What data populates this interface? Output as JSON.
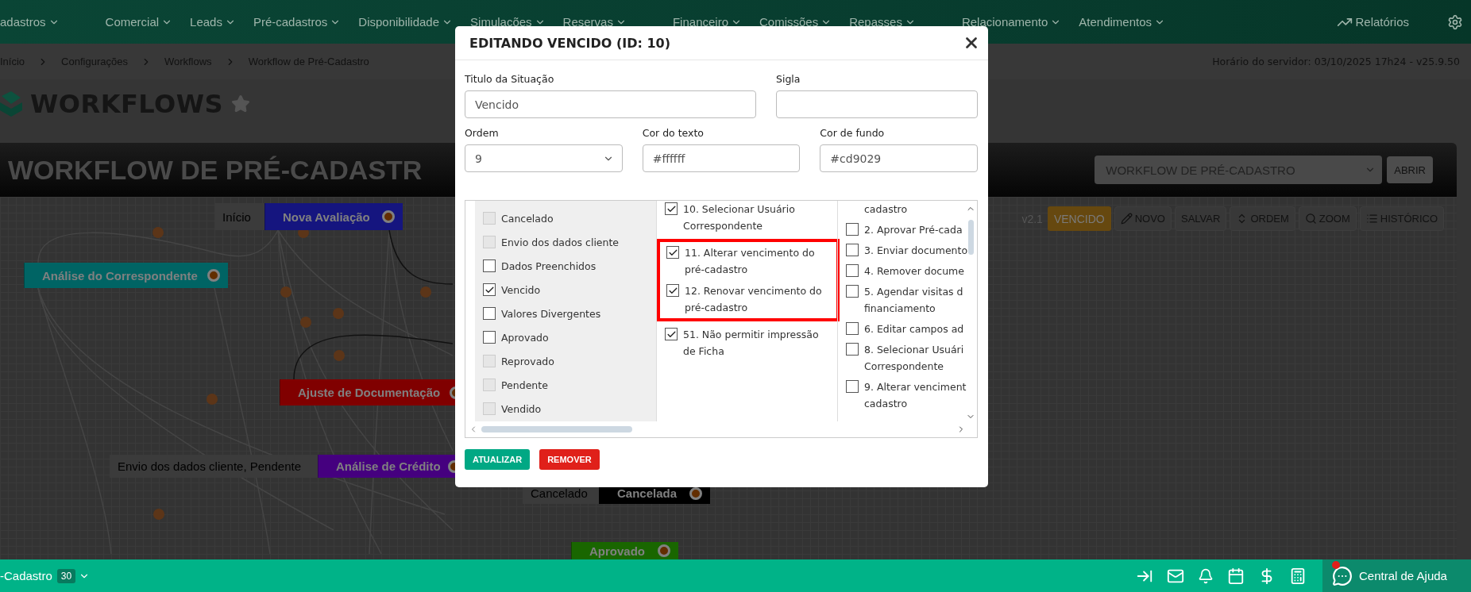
{
  "nav": {
    "items": [
      {
        "label": "adastros"
      },
      {
        "label": "Comercial"
      },
      {
        "label": "Leads"
      },
      {
        "label": "Pré-cadastros"
      },
      {
        "label": "Disponibilidade"
      },
      {
        "label": "Simulações"
      },
      {
        "label": "Reservas"
      },
      {
        "label": "Financeiro"
      },
      {
        "label": "Comissões"
      },
      {
        "label": "Repasses"
      },
      {
        "label": "Relacionamento"
      },
      {
        "label": "Atendimentos"
      }
    ],
    "reports": "Relatórios"
  },
  "breadcrumb": [
    "Início",
    "Configurações",
    "Workflows",
    "Workflow de Pré-Cadastro"
  ],
  "server_time": "Horário do servidor: 03/10/2025 17h24 - v25.9.50",
  "page_title": "WORKFLOWS",
  "banner": {
    "title": "WORKFLOW DE PRÉ-CADASTR",
    "select": "WORKFLOW DE PRÉ-CADASTRO",
    "button": "ABRIR"
  },
  "toolbar": {
    "version": "v2.1",
    "status": "VENCIDO",
    "buttons": [
      {
        "label": "NOVO",
        "kind": "pencil"
      },
      {
        "label": "SALVAR",
        "kind": "plain"
      },
      {
        "label": "ORDEM",
        "kind": "sort"
      },
      {
        "label": "ZOOM",
        "kind": "search"
      },
      {
        "label": "HISTÓRICO",
        "kind": "list"
      }
    ]
  },
  "canvas": {
    "nodes": [
      {
        "label": "Nova Avaliação",
        "tag": "Início",
        "color": "#15157f"
      },
      {
        "label": "Análise do Correspondente",
        "color": "#006464"
      },
      {
        "label": "Ajuste de Documentação",
        "color": "#800000"
      },
      {
        "label": "Análise de Crédito",
        "tag": "Envio dos dados cliente, Pendente",
        "color": "#45007f"
      },
      {
        "label": "Cancelada",
        "tag": "Cancelado",
        "color": "#000000"
      },
      {
        "label": "Aprovado",
        "color": "#196600"
      }
    ]
  },
  "modal": {
    "title": "EDITANDO VENCIDO (ID: 10)",
    "field_rows": [
      [
        {
          "label": "Titulo da Situação",
          "kind": "text",
          "value": "Vencido"
        },
        {
          "label": "Sigla",
          "kind": "text"
        }
      ],
      [
        {
          "label": "Ordem",
          "kind": "select",
          "value": "9"
        },
        {
          "label": "Cor do texto",
          "kind": "text",
          "value": "#ffffff"
        },
        {
          "label": "Cor de fundo",
          "kind": "text",
          "value": "#cd9029"
        }
      ]
    ],
    "situations": [
      {
        "label": "Cancelado",
        "checked": false,
        "disabled": true
      },
      {
        "label": "Envio dos dados cliente",
        "checked": false,
        "disabled": true
      },
      {
        "label": "Dados Preenchidos",
        "checked": false,
        "disabled": false
      },
      {
        "label": "Vencido",
        "checked": true,
        "disabled": false
      },
      {
        "label": "Valores Divergentes",
        "checked": false,
        "disabled": false
      },
      {
        "label": "Aprovado",
        "checked": false,
        "disabled": false
      },
      {
        "label": "Reprovado",
        "checked": false,
        "disabled": true
      },
      {
        "label": "Pendente",
        "checked": false,
        "disabled": true
      },
      {
        "label": "Vendido",
        "checked": false,
        "disabled": true
      }
    ],
    "actions": [
      {
        "lines": [
          "10. Selecionar Usuário",
          "Correspondente"
        ],
        "checked": true,
        "highlighted": false
      },
      {
        "lines": [
          "11. Alterar vencimento do",
          "pré-cadastro"
        ],
        "checked": true,
        "highlighted": true
      },
      {
        "lines": [
          "12. Renovar vencimento do",
          "pré-cadastro"
        ],
        "checked": true,
        "highlighted": true
      },
      {
        "lines": [
          "51. Não permitir impressão",
          "de Ficha"
        ],
        "checked": true,
        "highlighted": false
      }
    ],
    "other_actions": [
      {
        "kind": "continued",
        "lines": [
          "cadastro"
        ]
      },
      {
        "kind": "item",
        "lines": [
          "2. Aprovar Pré-cada"
        ],
        "checked": false
      },
      {
        "kind": "item",
        "lines": [
          "3. Enviar documento"
        ],
        "checked": false
      },
      {
        "kind": "item",
        "lines": [
          "4. Remover docume"
        ],
        "checked": false
      },
      {
        "kind": "item",
        "lines": [
          "5. Agendar visitas d",
          "financiamento"
        ],
        "checked": false
      },
      {
        "kind": "item",
        "lines": [
          "6. Editar campos ad"
        ],
        "checked": false
      },
      {
        "kind": "item",
        "lines": [
          "8. Selecionar Usuári",
          "Correspondente"
        ],
        "checked": false
      },
      {
        "kind": "item",
        "lines": [
          "9. Alterar venciment",
          "cadastro"
        ],
        "checked": false
      }
    ],
    "buttons": [
      {
        "label": "ATUALIZAR",
        "kind": "primary"
      },
      {
        "label": "REMOVER",
        "kind": "danger"
      }
    ]
  },
  "footer": {
    "label": "-Cadastro",
    "count": "30",
    "help": "Central de Ajuda",
    "notification": true
  }
}
